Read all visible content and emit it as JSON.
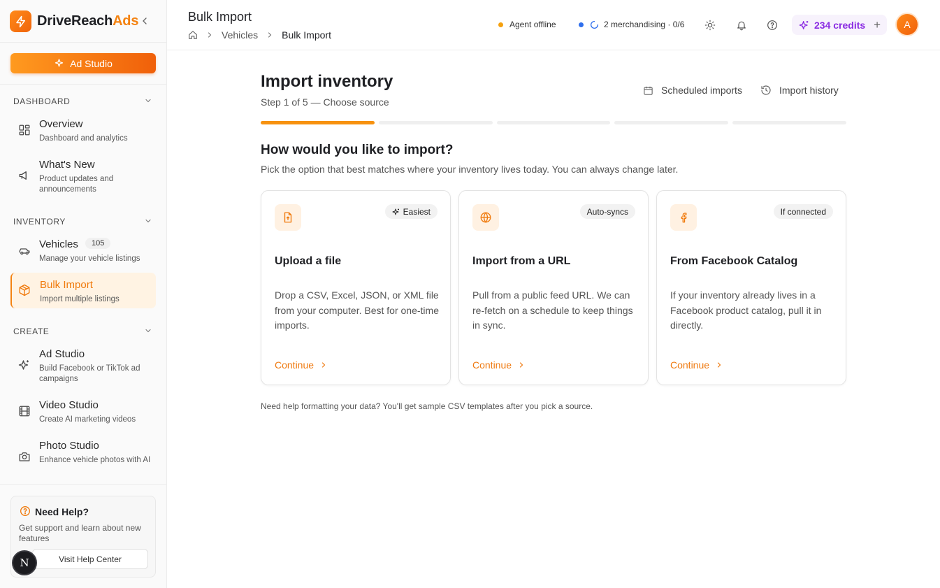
{
  "brand": {
    "name_a": "DriveReach",
    "name_b": "Ads",
    "accent": "#f48312"
  },
  "sidebar": {
    "ad_studio_button": "Ad Studio",
    "sections": [
      {
        "label": "DASHBOARD"
      },
      {
        "label": "INVENTORY"
      },
      {
        "label": "CREATE"
      }
    ],
    "items": [
      {
        "title": "Overview",
        "subtitle": "Dashboard and analytics",
        "icon": "grid-icon"
      },
      {
        "title": "What's New",
        "subtitle": "Product updates and announcements",
        "icon": "megaphone-icon"
      },
      {
        "title": "Vehicles",
        "subtitle": "Manage your vehicle listings",
        "badge": "105",
        "icon": "car-icon"
      },
      {
        "title": "Bulk Import",
        "subtitle": "Import multiple listings",
        "icon": "package-icon",
        "active": true
      },
      {
        "title": "Ad Studio",
        "subtitle": "Build Facebook or TikTok ad campaigns",
        "icon": "sparkle-icon"
      },
      {
        "title": "Video Studio",
        "subtitle": "Create AI marketing videos",
        "icon": "film-icon"
      },
      {
        "title": "Photo Studio",
        "subtitle": "Enhance vehicle photos with AI",
        "icon": "camera-icon"
      }
    ],
    "help": {
      "title": "Need Help?",
      "description": "Get support and learn about new features",
      "button": "Visit Help Center"
    },
    "n_badge": "N"
  },
  "header": {
    "title": "Bulk Import",
    "breadcrumb": [
      "Vehicles",
      "Bulk Import"
    ],
    "agent_status": "Agent offline",
    "merch_status": "2 merchandising · 0/6",
    "credits": "234 credits",
    "avatar_initial": "A",
    "colors": {
      "agent_dot": "#f5a10f",
      "merch_dot": "#2f6fed",
      "credits": "#8a2be2"
    }
  },
  "main": {
    "title": "Import inventory",
    "step": "Step 1 of 5 — Choose source",
    "links": {
      "scheduled": "Scheduled imports",
      "history": "Import history"
    },
    "progress": {
      "current": 1,
      "total": 5
    },
    "question": "How would you like to import?",
    "question_sub": "Pick the option that best matches where your inventory lives today. You can always change later.",
    "cards": [
      {
        "tag": "Easiest",
        "title": "Upload a file",
        "description": "Drop a CSV, Excel, JSON, or XML file from your computer. Best for one-time imports.",
        "cta": "Continue",
        "icon": "file-upload-icon"
      },
      {
        "tag": "Auto-syncs",
        "title": "Import from a URL",
        "description": "Pull from a public feed URL. We can re-fetch on a schedule to keep things in sync.",
        "cta": "Continue",
        "icon": "globe-icon"
      },
      {
        "tag": "If connected",
        "title": "From Facebook Catalog",
        "description": "If your inventory already lives in a Facebook product catalog, pull it in directly.",
        "cta": "Continue",
        "icon": "facebook-icon"
      }
    ],
    "footnote": "Need help formatting your data? You'll get sample CSV templates after you pick a source."
  }
}
